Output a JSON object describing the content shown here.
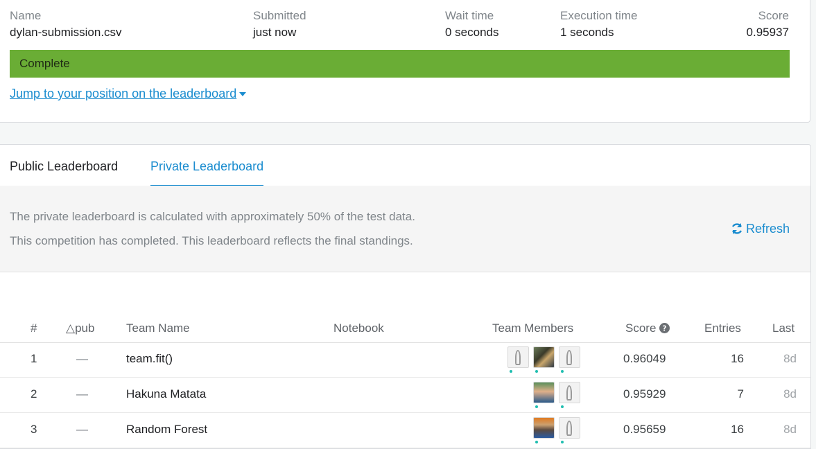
{
  "submission": {
    "name_header": "Name",
    "name_value": "dylan-submission.csv",
    "submitted_header": "Submitted",
    "submitted_value": "just now",
    "wait_header": "Wait time",
    "wait_value": "0 seconds",
    "exec_header": "Execution time",
    "exec_value": "1 seconds",
    "score_header": "Score",
    "score_value": "0.95937",
    "status": "Complete",
    "status_color": "#6aad35",
    "jump_link": "Jump to your position on the leaderboard"
  },
  "tabs": {
    "public": "Public Leaderboard",
    "private": "Private Leaderboard",
    "active": "private"
  },
  "info": {
    "line1": "The private leaderboard is calculated with approximately 50% of the test data.",
    "line2": "This competition has completed. This leaderboard reflects the final standings.",
    "refresh": "Refresh"
  },
  "table": {
    "headers": {
      "rank": "#",
      "delta": "△pub",
      "team": "Team Name",
      "notebook": "Notebook",
      "members": "Team Members",
      "score": "Score",
      "entries": "Entries",
      "last": "Last"
    },
    "rows": [
      {
        "rank": "1",
        "delta": "—",
        "team": "team.fit()",
        "score": "0.96049",
        "entries": "16",
        "last": "8d",
        "members": [
          "goose",
          "photo",
          "goose"
        ]
      },
      {
        "rank": "2",
        "delta": "—",
        "team": "Hakuna Matata",
        "score": "0.95929",
        "entries": "7",
        "last": "8d",
        "members": [
          "photo",
          "goose"
        ]
      },
      {
        "rank": "3",
        "delta": "—",
        "team": "Random Forest",
        "score": "0.95659",
        "entries": "16",
        "last": "8d",
        "members": [
          "photo",
          "goose"
        ]
      }
    ]
  },
  "colors": {
    "accent": "#1a8ccf",
    "online_dot": "#20beb0"
  },
  "icons": {
    "refresh": "refresh-icon",
    "caret": "caret-down-icon",
    "help": "help-icon"
  }
}
